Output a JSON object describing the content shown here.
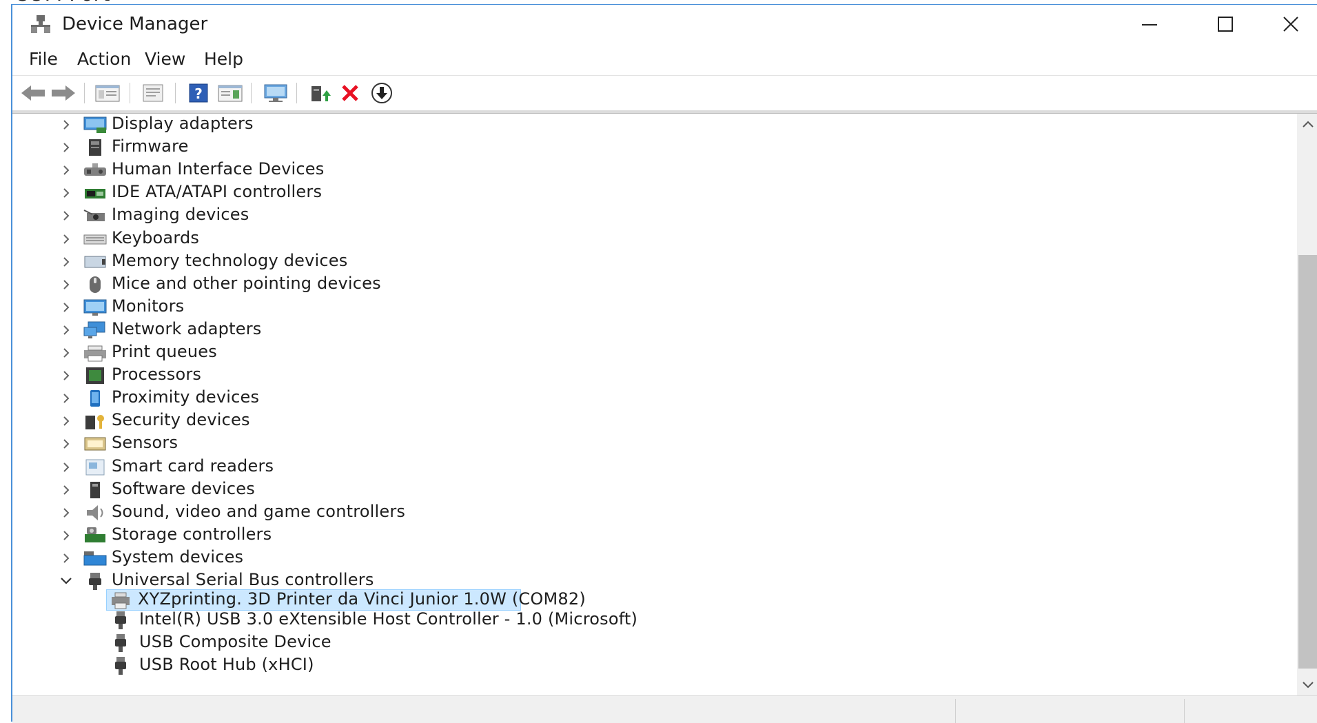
{
  "top_fragment": "COM Port",
  "window": {
    "title": "Device Manager",
    "controls": {
      "minimize": "minimize",
      "maximize": "maximize",
      "close": "close"
    }
  },
  "menu": [
    "File",
    "Action",
    "View",
    "Help"
  ],
  "toolbar": [
    "back-arrow",
    "forward-arrow",
    "show-hide-console-tree",
    "properties",
    "help",
    "action-pane",
    "scan-hardware",
    "update-driver",
    "uninstall-device",
    "download-driver"
  ],
  "tree": {
    "categories": [
      "Display adapters",
      "Firmware",
      "Human Interface Devices",
      "IDE ATA/ATAPI controllers",
      "Imaging devices",
      "Keyboards",
      "Memory technology devices",
      "Mice and other pointing devices",
      "Monitors",
      "Network adapters",
      "Print queues",
      "Processors",
      "Proximity devices",
      "Security devices",
      "Sensors",
      "Smart card readers",
      "Software devices",
      "Sound, video and game controllers",
      "Storage controllers",
      "System devices",
      "Universal Serial Bus controllers"
    ],
    "expanded_category": "Universal Serial Bus controllers",
    "children": [
      "XYZprinting. 3D Printer da Vinci Junior 1.0W (COM82)",
      "Intel(R) USB 3.0 eXtensible Host Controller - 1.0 (Microsoft)",
      "USB Composite Device",
      "USB Root Hub (xHCI)"
    ],
    "selected_child": "XYZprinting. 3D Printer da Vinci Junior 1.0W (COM82)"
  },
  "colors": {
    "selection_bg": "#cce8ff",
    "selection_border": "#99d1ff",
    "window_border": "#4a90d9",
    "uninstall_red": "#e81123"
  }
}
